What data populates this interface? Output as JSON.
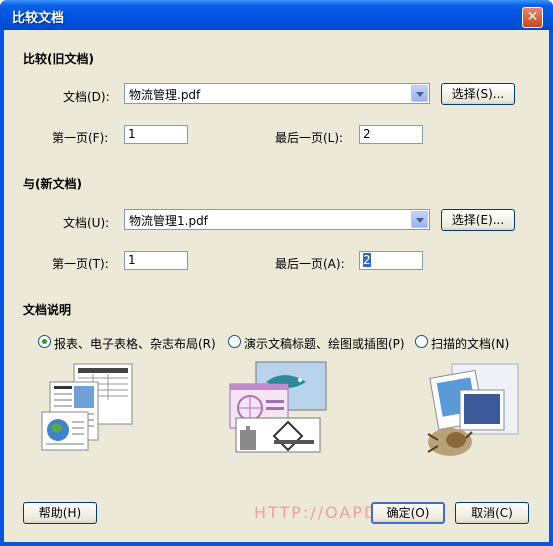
{
  "window": {
    "title": "比较文档",
    "close_glyph": "✕"
  },
  "old_doc": {
    "section_title": "比较(旧文档)",
    "doc_label": "文档(D):",
    "doc_value": "物流管理.pdf",
    "choose_label": "选择(S)...",
    "first_page_label": "第一页(F):",
    "first_page_value": "1",
    "last_page_label": "最后一页(L):",
    "last_page_value": "2"
  },
  "new_doc": {
    "section_title": "与(新文档)",
    "doc_label": "文档(U):",
    "doc_value": "物流管理1.pdf",
    "choose_label": "选择(E)...",
    "first_page_label": "第一页(T):",
    "first_page_value": "1",
    "last_page_label": "最后一页(A):",
    "last_page_value": "2"
  },
  "doc_desc": {
    "section_title": "文档说明",
    "options": [
      {
        "label": "报表、电子表格、杂志布局(R)",
        "selected": true
      },
      {
        "label": "演示文稿标题、绘图或插图(P)",
        "selected": false
      },
      {
        "label": "扫描的文档(N)",
        "selected": false
      }
    ],
    "illustrations": [
      "report-spreadsheet-illustration",
      "presentation-drawing-illustration",
      "scanned-document-illustration"
    ]
  },
  "watermark": "HTTP://OAPDF.COM",
  "buttons": {
    "help": "帮助(H)",
    "ok": "确定(O)",
    "cancel": "取消(C)"
  }
}
